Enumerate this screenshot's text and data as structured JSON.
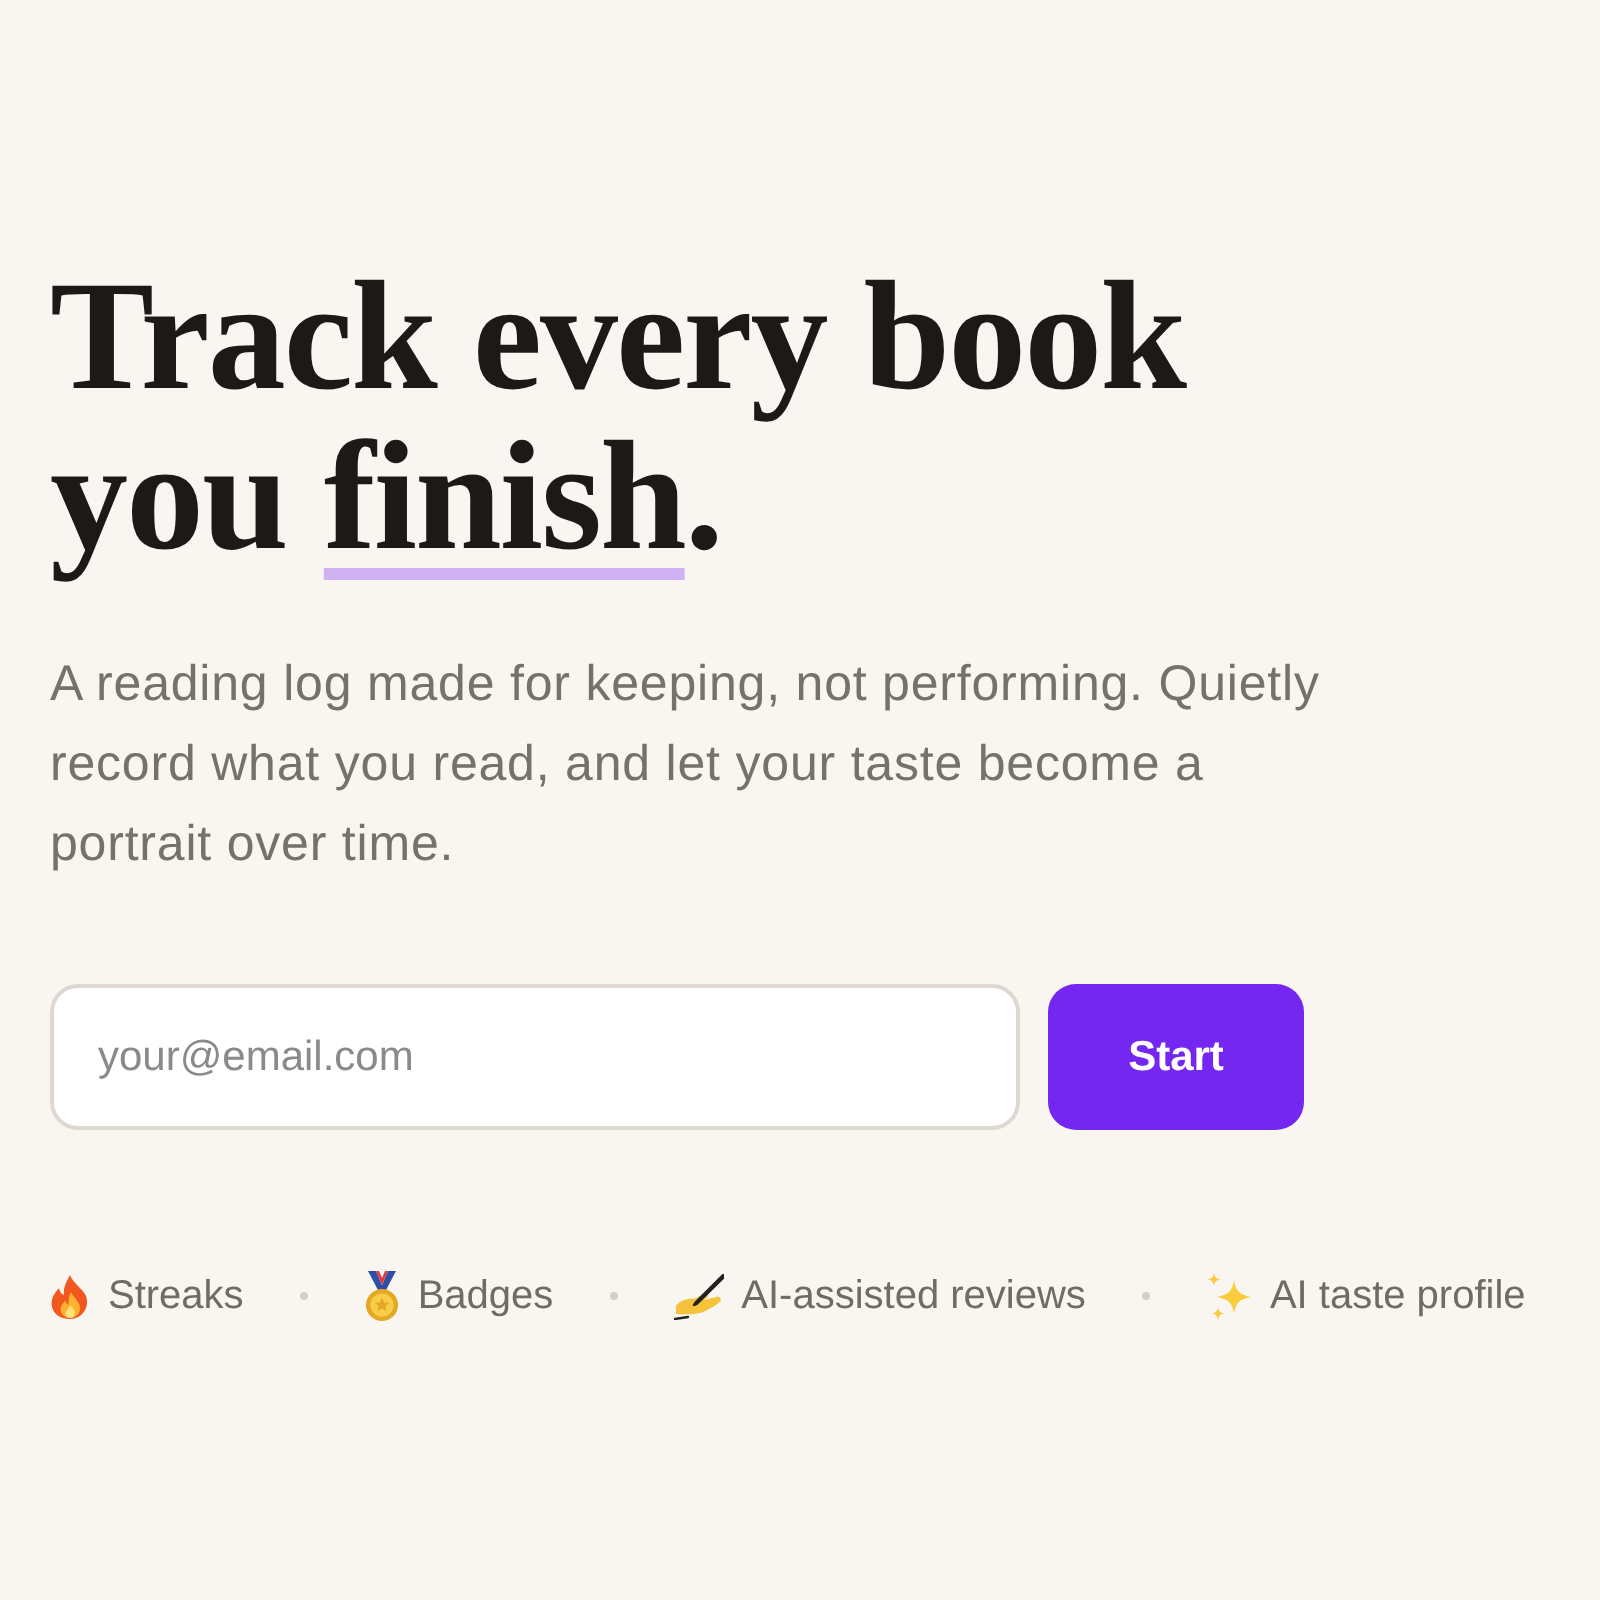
{
  "hero": {
    "title": {
      "before": "Track every book you ",
      "highlight": "finish",
      "after": "."
    },
    "subtitle": "A reading log made for keeping, not performing. Quietly record what you read, and let your taste become a portrait over time.",
    "signup": {
      "placeholder": "your@email.com",
      "button": "Start"
    }
  },
  "features": [
    {
      "label": "Streaks"
    },
    {
      "label": "Badges"
    },
    {
      "label": "AI-assisted reviews"
    },
    {
      "label": "AI taste profile"
    }
  ]
}
